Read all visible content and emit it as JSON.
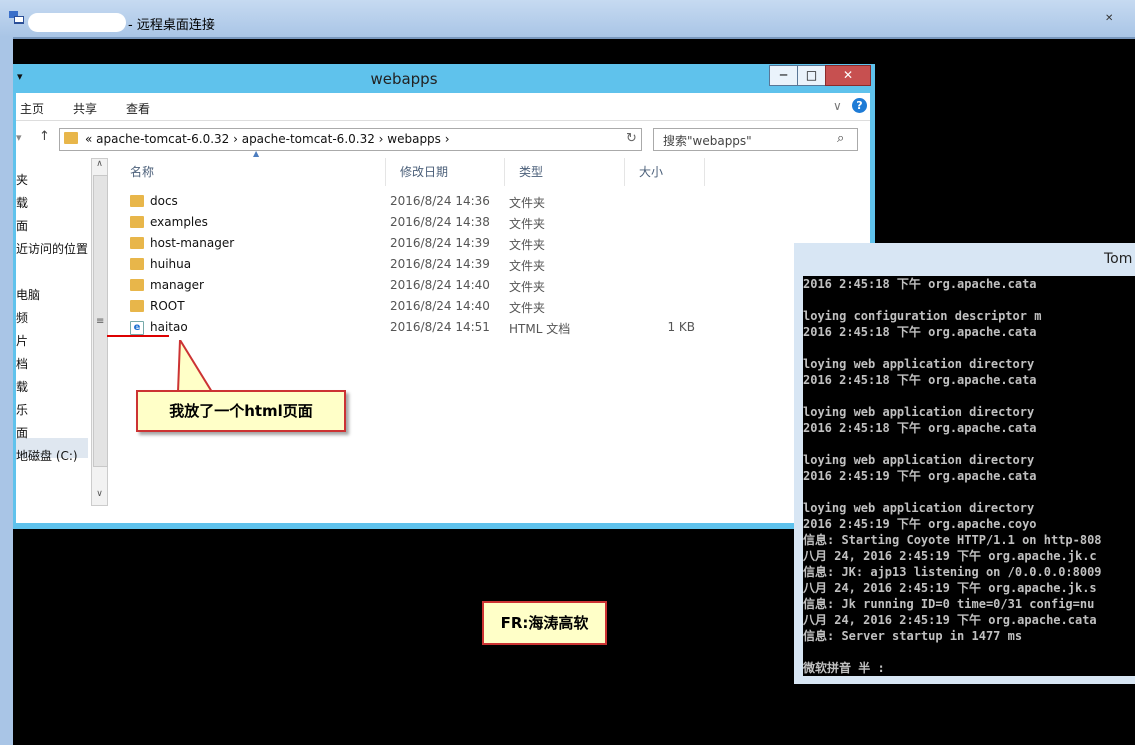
{
  "rdp": {
    "title": "- 远程桌面连接",
    "close_glyph": "✕"
  },
  "explorer": {
    "title": "webapps",
    "qa_glyph": "▾",
    "buttons": {
      "min": "─",
      "max": "□",
      "close": "✕"
    },
    "ribbon": {
      "tabs": [
        "主页",
        "共享",
        "查看"
      ],
      "chevron": "∨",
      "help": "?"
    },
    "nav": {
      "back": "▾",
      "up": "↑"
    },
    "address": "«  apache-tomcat-6.0.32  ›  apache-tomcat-6.0.32  ›  webapps  ›",
    "refresh_glyph": "↻",
    "search": {
      "placeholder": "搜索\"webapps\"",
      "icon": "⌕"
    },
    "navpane": [
      "夹",
      "载",
      "面",
      "近访问的位置",
      "电脑",
      "频",
      "片",
      "档",
      "载",
      "乐",
      "面",
      "地磁盘 (C:)"
    ],
    "scroll": {
      "up": "∧",
      "down": "∨",
      "grip": "≡"
    },
    "columns": {
      "name": "名称",
      "date": "修改日期",
      "type": "类型",
      "size": "大小"
    },
    "sort_glyph": "▲",
    "files": [
      {
        "name": "docs",
        "date": "2016/8/24 14:36",
        "type": "文件夹",
        "size": "",
        "icon": "folder"
      },
      {
        "name": "examples",
        "date": "2016/8/24 14:38",
        "type": "文件夹",
        "size": "",
        "icon": "folder"
      },
      {
        "name": "host-manager",
        "date": "2016/8/24 14:39",
        "type": "文件夹",
        "size": "",
        "icon": "folder"
      },
      {
        "name": "huihua",
        "date": "2016/8/24 14:39",
        "type": "文件夹",
        "size": "",
        "icon": "folder"
      },
      {
        "name": "manager",
        "date": "2016/8/24 14:40",
        "type": "文件夹",
        "size": "",
        "icon": "folder"
      },
      {
        "name": "ROOT",
        "date": "2016/8/24 14:40",
        "type": "文件夹",
        "size": "",
        "icon": "folder"
      },
      {
        "name": "haitao",
        "date": "2016/8/24 14:51",
        "type": "HTML 文档",
        "size": "1 KB",
        "icon": "ie-html"
      }
    ],
    "view_buttons": {
      "details": "☷",
      "thumbnails": "▣"
    }
  },
  "callouts": {
    "note": "我放了一个html页面",
    "credit": "FR:海涛高软"
  },
  "console": {
    "title": "Tom",
    "lines": [
      "2016 2:45:18 下午 org.apache.cata",
      "",
      "loying configuration descriptor m",
      "2016 2:45:18 下午 org.apache.cata",
      "",
      "loying web application directory",
      "2016 2:45:18 下午 org.apache.cata",
      "",
      "loying web application directory",
      "2016 2:45:18 下午 org.apache.cata",
      "",
      "loying web application directory",
      "2016 2:45:19 下午 org.apache.cata",
      "",
      "loying web application directory",
      "2016 2:45:19 下午 org.apache.coyo",
      "信息: Starting Coyote HTTP/1.1 on http-808",
      "八月 24, 2016 2:45:19 下午 org.apache.jk.c",
      "信息: JK: ajp13 listening on /0.0.0.0:8009",
      "八月 24, 2016 2:45:19 下午 org.apache.jk.s",
      "信息: Jk running ID=0 time=0/31  config=nu",
      "八月 24, 2016 2:45:19 下午 org.apache.cata",
      "信息: Server startup in 1477 ms",
      "",
      "微软拼音 半 :"
    ]
  }
}
